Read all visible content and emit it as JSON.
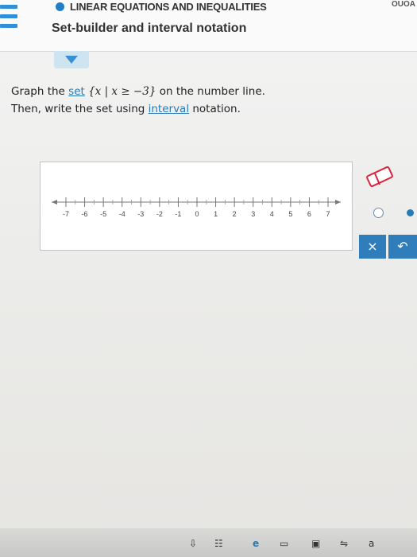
{
  "header": {
    "topic": "LINEAR EQUATIONS AND INEQUALITIES",
    "subtopic": "Set-builder and interval notation",
    "corner_text": "OUOA"
  },
  "question": {
    "line1_prefix": "Graph the ",
    "set_link": "set",
    "set_expression": "{x | x ≥ −3}",
    "line1_suffix": " on the number line.",
    "line2_prefix": "Then, write the set using ",
    "interval_link": "interval",
    "line2_suffix": " notation."
  },
  "number_line": {
    "min": -7,
    "max": 7,
    "tick_labels": [
      "-7",
      "-6",
      "-5",
      "-4",
      "-3",
      "-2",
      "-1",
      "0",
      "1",
      "2",
      "3",
      "4",
      "5",
      "6",
      "7"
    ]
  },
  "tools": {
    "eraser_icon": "eraser-icon",
    "open_point_icon": "open-circle-icon",
    "closed_point_icon": "closed-circle-icon",
    "clear_label": "×",
    "undo_label": "↶",
    "accent_color": "#2f7dbb"
  },
  "taskbar": {
    "items": [
      "⇩",
      "☷",
      "e",
      "▭",
      "▣",
      "⇋",
      "a"
    ]
  }
}
